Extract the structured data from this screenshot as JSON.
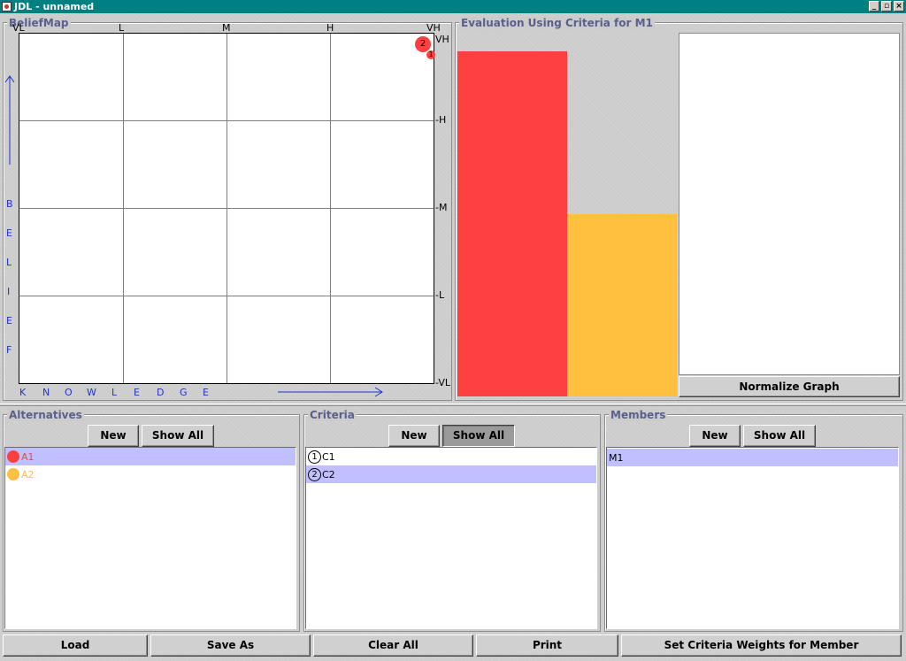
{
  "window": {
    "title": "JDL - unnamed",
    "buttons": [
      "minimize",
      "maximize",
      "close"
    ]
  },
  "belief_map": {
    "title": "BeliefMap",
    "x_ticks": [
      "VL",
      "L",
      "M",
      "H",
      "VH"
    ],
    "y_ticks": [
      "VH",
      "-H",
      "-M",
      "-L",
      "-VL"
    ],
    "x_axis_letters": [
      "K",
      "N",
      "O",
      "W",
      "L",
      "E",
      "D",
      "G",
      "E"
    ],
    "y_axis_letters": [
      "B",
      "E",
      "L",
      "I",
      "E",
      "F"
    ],
    "markers": [
      {
        "label": "2",
        "color": "#ff4040",
        "knowledge": 0.97,
        "belief": 0.97
      },
      {
        "label": "1",
        "color": "#ff4040",
        "knowledge": 0.99,
        "belief": 0.94
      }
    ]
  },
  "evaluation": {
    "title": "Evaluation Using Criteria for M1",
    "bars": [
      {
        "name": "A1",
        "color": "#ff4040",
        "value": 0.95
      },
      {
        "name": "A2",
        "color": "#ffc040",
        "value": 0.5
      }
    ],
    "normalize_label": "Normalize Graph"
  },
  "alternatives": {
    "title": "Alternatives",
    "new_label": "New",
    "show_all_label": "Show All",
    "items": [
      {
        "label": "A1",
        "color": "#ff4040",
        "selected": true
      },
      {
        "label": "A2",
        "color": "#ffc040",
        "selected": false
      }
    ]
  },
  "criteria": {
    "title": "Criteria",
    "new_label": "New",
    "show_all_label": "Show All",
    "items": [
      {
        "num": "1",
        "label": "C1",
        "selected": false
      },
      {
        "num": "2",
        "label": "C2",
        "selected": true
      }
    ]
  },
  "members": {
    "title": "Members",
    "new_label": "New",
    "show_all_label": "Show All",
    "items": [
      {
        "label": "M1",
        "selected": true
      }
    ]
  },
  "bottom_bar": {
    "load": "Load",
    "save_as": "Save As",
    "clear_all": "Clear All",
    "print": "Print",
    "set_weights": "Set Criteria Weights for Member"
  }
}
